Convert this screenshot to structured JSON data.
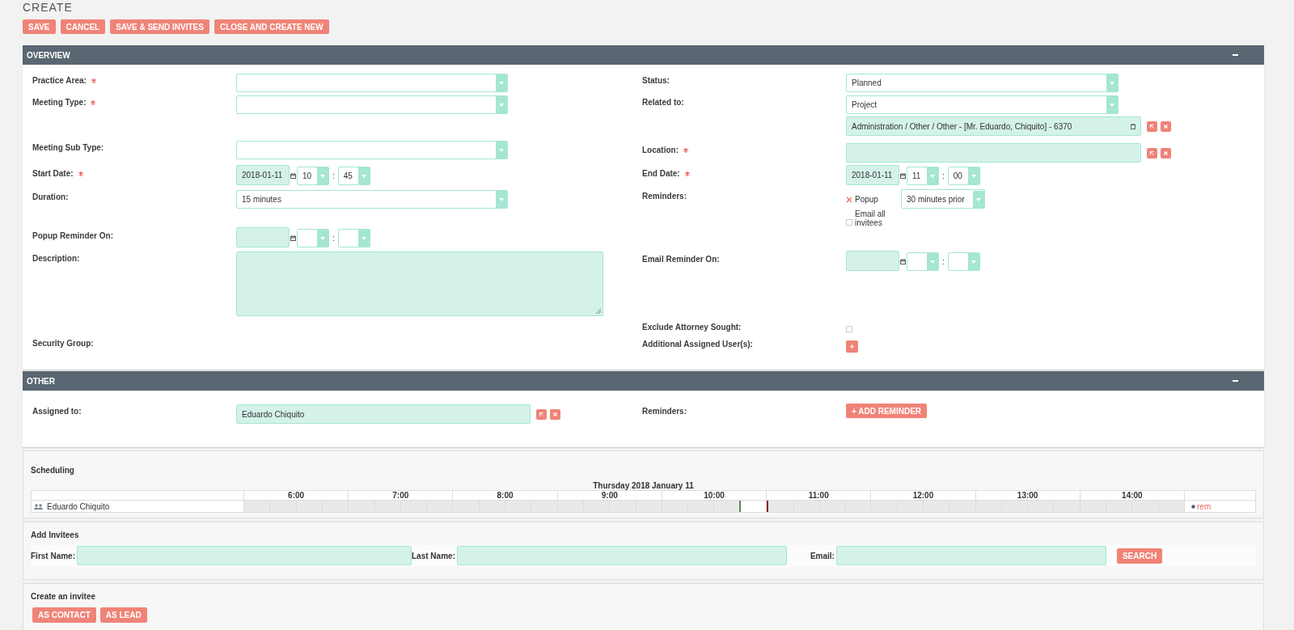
{
  "page_title": "CREATE",
  "actions": [
    {
      "label": "SAVE"
    },
    {
      "label": "CANCEL"
    },
    {
      "label": "SAVE & SEND INVITES"
    },
    {
      "label": "CLOSE AND CREATE NEW"
    }
  ],
  "overview": {
    "title": "OVERVIEW",
    "left": [
      {
        "label": "Practice Area:",
        "required": true,
        "kind": "select"
      },
      {
        "label": "Meeting Type:",
        "required": true,
        "kind": "select"
      },
      {
        "label": "Meeting Sub Type:",
        "required": false,
        "kind": "select"
      },
      {
        "label": "Start Date:",
        "required": true,
        "kind": "datetime",
        "date": "2018-01-11",
        "hour": "10",
        "minute": "45",
        "separator": ":"
      },
      {
        "label": "Duration:",
        "required": false,
        "kind": "select",
        "value": "15 minutes"
      },
      {
        "label": "Popup Reminder On:",
        "required": false,
        "kind": "datetime",
        "separator": ":"
      },
      {
        "label": "Description:",
        "required": false,
        "kind": "textarea"
      },
      {
        "label": "Security Group:",
        "required": false,
        "kind": "none"
      }
    ],
    "right": [
      {
        "label": "Status:",
        "required": false,
        "kind": "select",
        "value": "Planned"
      },
      {
        "label": "Related to:",
        "required": false,
        "kind": "select",
        "value": "Project"
      },
      {
        "kind": "relate",
        "value": "Administration / Other / Other - [Mr. Eduardo, Chiquito] - 6370"
      },
      {
        "label": "Location:",
        "required": true,
        "kind": "relate"
      },
      {
        "label": "End Date:",
        "required": true,
        "kind": "datetime",
        "date": "2018-01-11",
        "hour": "11",
        "minute": "00",
        "separator": ":"
      },
      {
        "label": "Reminders:",
        "required": false,
        "kind": "reminders",
        "popup": {
          "label": "Popup",
          "checked": true,
          "value": "30 minutes prior"
        },
        "email": {
          "label": "Email all invitees",
          "checked": false
        }
      },
      {
        "label": "Email Reminder On:",
        "required": false,
        "kind": "datetime",
        "separator": ":"
      },
      {
        "label": "Exclude Attorney Sought:",
        "required": false,
        "kind": "checkbox",
        "checked": false
      },
      {
        "label": "Additional Assigned User(s):",
        "required": false,
        "kind": "add"
      }
    ]
  },
  "other": {
    "title": "OTHER",
    "left": [
      {
        "label": "Assigned to:",
        "required": false,
        "kind": "relate",
        "value": "Eduardo Chiquito"
      }
    ],
    "right": [
      {
        "label": "Reminders:",
        "required": false,
        "kind": "button",
        "button": "+ ADD REMINDER"
      }
    ]
  },
  "scheduling": {
    "title": "Scheduling",
    "date": "Thursday 2018 January 11",
    "hours": [
      "6:00",
      "7:00",
      "8:00",
      "9:00",
      "10:00",
      "11:00",
      "12:00",
      "13:00",
      "14:00"
    ],
    "rows": [
      {
        "name": "Eduardo Chiquito",
        "action": "rem"
      }
    ]
  },
  "invitees": {
    "title": "Add Invitees",
    "fields": [
      {
        "label": "First Name:"
      },
      {
        "label": "Last Name:"
      },
      {
        "label": "Email:"
      }
    ],
    "button": "SEARCH"
  },
  "create_invitee": {
    "title": "Create an invitee",
    "buttons": [
      {
        "label": "AS CONTACT"
      },
      {
        "label": "AS LEAD"
      }
    ]
  }
}
